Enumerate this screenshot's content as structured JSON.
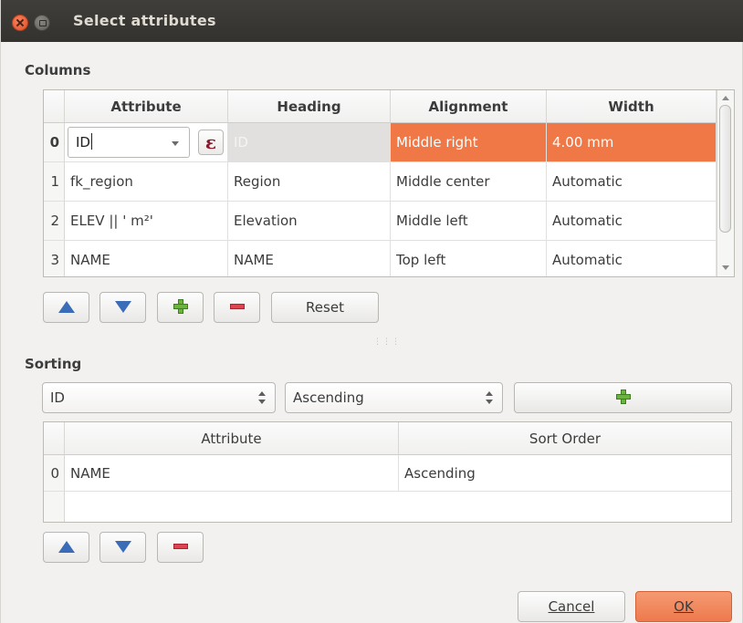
{
  "window": {
    "title": "Select attributes"
  },
  "columns": {
    "section_title": "Columns",
    "headers": [
      "Attribute",
      "Heading",
      "Alignment",
      "Width"
    ],
    "rows": [
      {
        "index": "0",
        "attribute": "ID",
        "heading": "ID",
        "alignment": "Middle right",
        "width": "4.00 mm",
        "selected": true
      },
      {
        "index": "1",
        "attribute": "fk_region",
        "heading": "Region",
        "alignment": "Middle center",
        "width": "Automatic"
      },
      {
        "index": "2",
        "attribute": "ELEV || ' m²'",
        "heading": "Elevation",
        "alignment": "Middle left",
        "width": "Automatic"
      },
      {
        "index": "3",
        "attribute": "NAME",
        "heading": "NAME",
        "alignment": "Top left",
        "width": "Automatic"
      }
    ],
    "expression_button_icon": "ε",
    "buttons": {
      "move_up_icon": "up-arrow-icon",
      "move_down_icon": "down-arrow-icon",
      "add_icon": "plus-icon",
      "remove_icon": "minus-icon",
      "reset_label": "Reset"
    }
  },
  "sorting": {
    "section_title": "Sorting",
    "attribute_combo_value": "ID",
    "order_combo_value": "Ascending",
    "headers": [
      "Attribute",
      "Sort Order"
    ],
    "rows": [
      {
        "index": "0",
        "attribute": "NAME",
        "sort_order": "Ascending"
      }
    ]
  },
  "footer": {
    "cancel_label": "Cancel",
    "ok_label": "OK"
  },
  "colors": {
    "selection": "#f07746",
    "titlebar": "#3c3b37",
    "accent_button": "#ee7a4d"
  }
}
